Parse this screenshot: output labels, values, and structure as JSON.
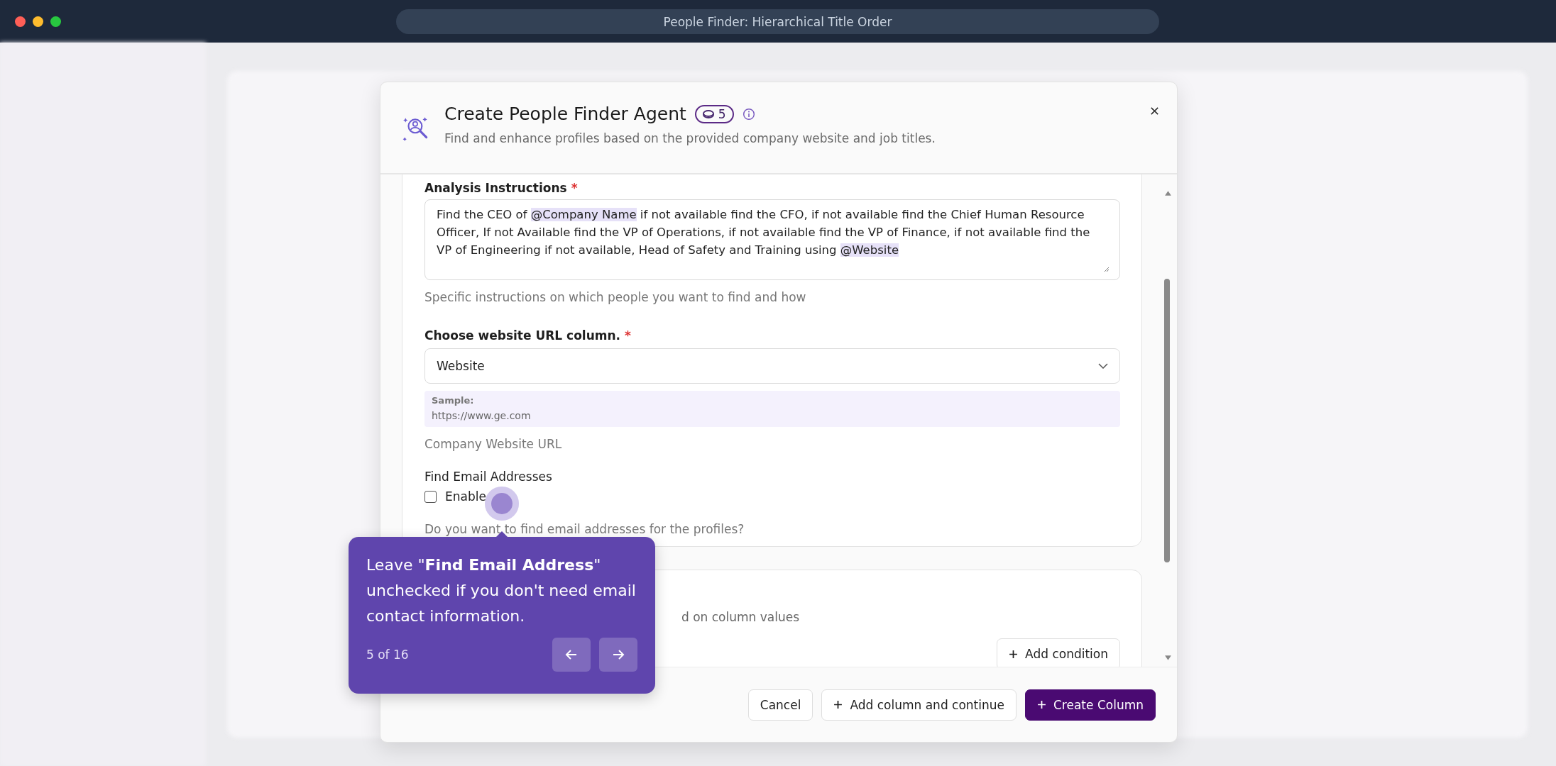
{
  "window": {
    "title": "People Finder: Hierarchical Title Order"
  },
  "modal": {
    "title": "Create People Finder Agent",
    "credit_badge": "5",
    "subtitle": "Find and enhance profiles based on the provided company website and job titles.",
    "instructions": {
      "label": "Analysis Instructions",
      "required_mark": "*",
      "value": [
        {
          "kind": "text",
          "text": "Find the CEO of "
        },
        {
          "kind": "mention",
          "text": "@Company Name"
        },
        {
          "kind": "text",
          "text": "   if not available find the CFO, if not available find the Chief Human Resource Officer, If not Available find the VP of Operations, if not available find the VP of Finance, if not available find the VP of Engineering if not available, Head of Safety and Training using "
        },
        {
          "kind": "mention",
          "text": "@Website"
        }
      ],
      "helper": "Specific instructions on which people you want to find and how"
    },
    "url_column": {
      "label": "Choose website URL column.",
      "required_mark": "*",
      "value": "Website",
      "sample_label": "Sample:",
      "sample_value": "https://www.ge.com",
      "helper": "Company Website URL"
    },
    "email": {
      "label": "Find Email Addresses",
      "checkbox_label": "Enable",
      "checked": false,
      "helper": "Do you want to find email addresses for the profiles?"
    },
    "conditions": {
      "partial_text": "d on column values",
      "button": "Add condition"
    },
    "footer_buttons": [
      {
        "kind": "secondary",
        "label": "Cancel"
      },
      {
        "kind": "secondary_plus",
        "label": "Add column and continue"
      },
      {
        "kind": "primary_plus",
        "label": "Create Column"
      }
    ]
  },
  "tooltip": {
    "text": "Leave \"**Find Email Address**\" unchecked if you don't need email contact information.",
    "counter": "5 of 16"
  }
}
